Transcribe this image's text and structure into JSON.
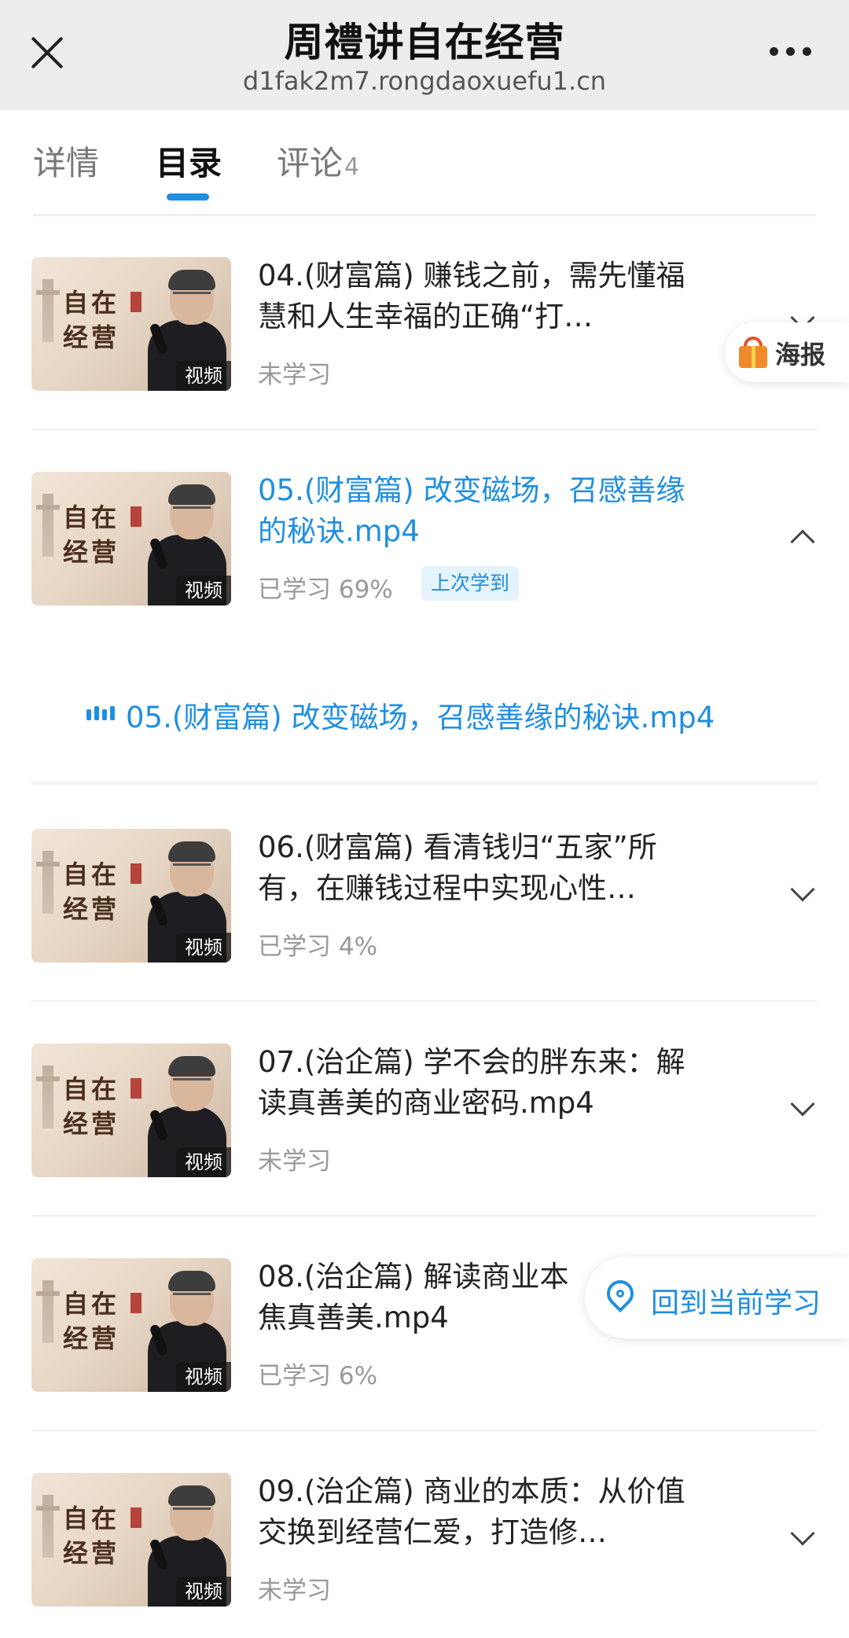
{
  "header": {
    "title": "周禮讲自在经营",
    "url": "d1fak2m7.rongdaoxuefu1.cn"
  },
  "tabs": [
    {
      "label": "详情"
    },
    {
      "label": "目录"
    },
    {
      "label": "评论",
      "count": "4"
    }
  ],
  "thumbnail": {
    "title_line1": "自在",
    "title_line2": "经营",
    "badge": "视频"
  },
  "lessons": [
    {
      "title": "04.(财富篇) 赚钱之前，需先懂福慧和人生幸福的正确“打…",
      "status": "未学习"
    },
    {
      "title": "05.(财富篇) 改变磁场，召感善缘的秘诀.mp4",
      "status": "已学习 69%",
      "badge": "上次学到"
    },
    {
      "title": "06.(财富篇) 看清钱归“五家”所有，在赚钱过程中实现心性…",
      "status": "已学习 4%"
    },
    {
      "title": "07.(治企篇) 学不会的胖东来：解读真善美的商业密码.mp4",
      "status": "未学习"
    },
    {
      "title": "08.(治企篇) 解读商业本质，聚焦真善美.mp4",
      "title_visible": "08.(治企篇) 解读商业本",
      "title_line2": "焦真善美.mp4",
      "status": "已学习 6%"
    },
    {
      "title": "09.(治企篇) 商业的本质：从价值交换到经营仁爱，打造修…",
      "status": "未学习"
    }
  ],
  "expanded_item": {
    "title": "05.(财富篇) 改变磁场，召感善缘的秘诀.mp4"
  },
  "floating": {
    "poster_label": "海报",
    "locate_label": "回到当前学习"
  },
  "colors": {
    "accent": "#1f8fe0",
    "header_bg": "#ededed",
    "resume_badge_bg": "#e5f3fd"
  }
}
